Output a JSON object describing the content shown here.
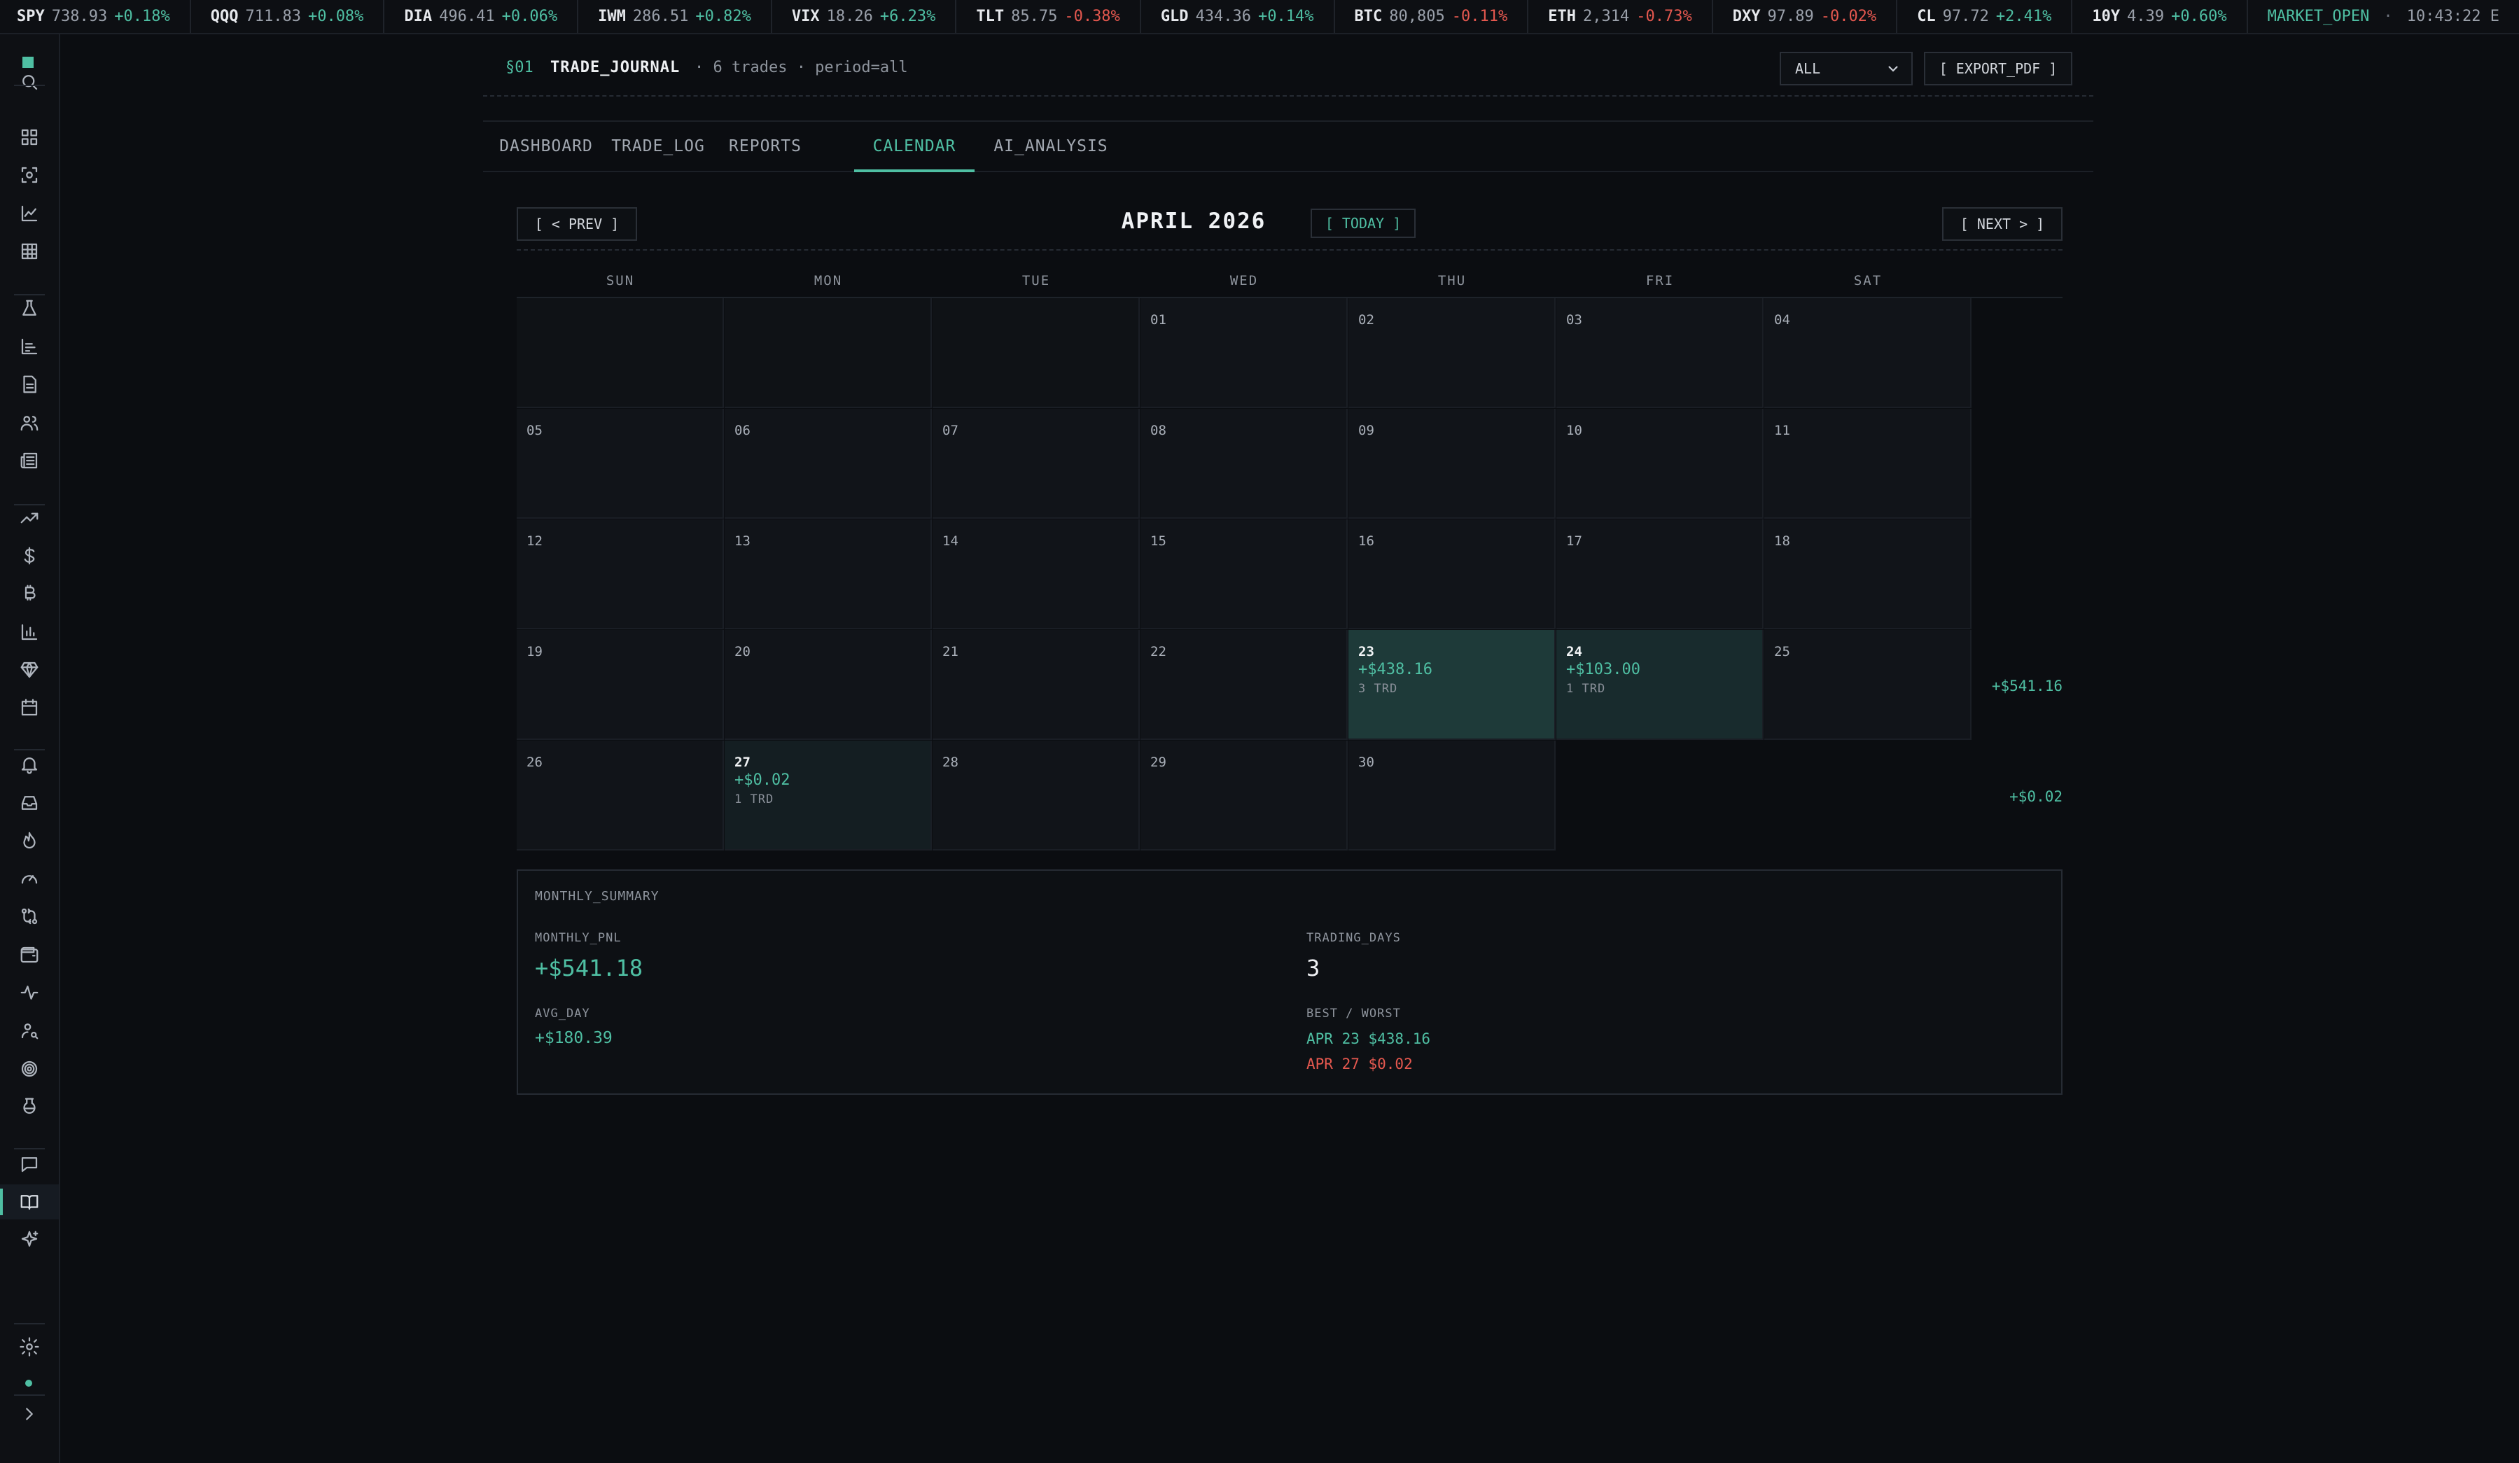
{
  "ticker": [
    {
      "symbol": "SPY",
      "price": "738.93",
      "change": "+0.18%",
      "dir": "up"
    },
    {
      "symbol": "QQQ",
      "price": "711.83",
      "change": "+0.08%",
      "dir": "up"
    },
    {
      "symbol": "DIA",
      "price": "496.41",
      "change": "+0.06%",
      "dir": "up"
    },
    {
      "symbol": "IWM",
      "price": "286.51",
      "change": "+0.82%",
      "dir": "up"
    },
    {
      "symbol": "VIX",
      "price": "18.26",
      "change": "+6.23%",
      "dir": "up"
    },
    {
      "symbol": "TLT",
      "price": "85.75",
      "change": "-0.38%",
      "dir": "down"
    },
    {
      "symbol": "GLD",
      "price": "434.36",
      "change": "+0.14%",
      "dir": "up"
    },
    {
      "symbol": "BTC",
      "price": "80,805",
      "change": "-0.11%",
      "dir": "down"
    },
    {
      "symbol": "ETH",
      "price": "2,314",
      "change": "-0.73%",
      "dir": "down"
    },
    {
      "symbol": "DXY",
      "price": "97.89",
      "change": "-0.02%",
      "dir": "down"
    },
    {
      "symbol": "CL",
      "price": "97.72",
      "change": "+2.41%",
      "dir": "up"
    },
    {
      "symbol": "10Y",
      "price": "4.39",
      "change": "+0.60%",
      "dir": "up"
    }
  ],
  "market": {
    "status": "MARKET_OPEN",
    "separator": "·",
    "clock": "10:43:22 E"
  },
  "sidebar_icons": [
    "logo-icon",
    "search-icon",
    "dashboard-icon",
    "scan-icon",
    "line-chart-icon",
    "grid-icon",
    "flask-icon",
    "bar-chart-icon",
    "document-icon",
    "users-icon",
    "newspaper-icon",
    "trending-up-icon",
    "dollar-icon",
    "bitcoin-icon",
    "column-chart-icon",
    "gem-icon",
    "calendar-icon",
    "bell-icon",
    "inbox-icon",
    "flame-icon",
    "gauge-icon",
    "exchange-icon",
    "wallet-icon",
    "activity-icon",
    "user-search-icon",
    "target-icon",
    "beaker-icon",
    "chat-icon",
    "book-open-icon",
    "sparkles-icon",
    "settings-icon",
    "expand-icon"
  ],
  "header": {
    "section": "§01",
    "title": "TRADE_JOURNAL",
    "meta": "· 6 trades · period=all",
    "filter_value": "ALL",
    "export_label": "[ EXPORT_PDF ]"
  },
  "tabs": [
    {
      "label": "DASHBOARD",
      "active": false
    },
    {
      "label": "TRADE_LOG",
      "active": false
    },
    {
      "label": "REPORTS",
      "active": false
    },
    {
      "label": "CALENDAR",
      "active": true
    },
    {
      "label": "AI_ANALYSIS",
      "active": false
    }
  ],
  "calendar": {
    "prev_label": "[ < PREV ]",
    "next_label": "[ NEXT > ]",
    "month_title": "APRIL 2026",
    "today_label": "[ TODAY ]",
    "weekdays": [
      "SUN",
      "MON",
      "TUE",
      "WED",
      "THU",
      "FRI",
      "SAT"
    ],
    "weeks": [
      {
        "days": [
          null,
          null,
          null,
          {
            "d": "01"
          },
          {
            "d": "02"
          },
          {
            "d": "03"
          },
          {
            "d": "04"
          }
        ],
        "total": ""
      },
      {
        "days": [
          {
            "d": "05"
          },
          {
            "d": "06"
          },
          {
            "d": "07"
          },
          {
            "d": "08"
          },
          {
            "d": "09"
          },
          {
            "d": "10"
          },
          {
            "d": "11"
          }
        ],
        "total": ""
      },
      {
        "days": [
          {
            "d": "12"
          },
          {
            "d": "13"
          },
          {
            "d": "14"
          },
          {
            "d": "15"
          },
          {
            "d": "16"
          },
          {
            "d": "17"
          },
          {
            "d": "18"
          }
        ],
        "total": ""
      },
      {
        "days": [
          {
            "d": "19"
          },
          {
            "d": "20"
          },
          {
            "d": "21"
          },
          {
            "d": "22"
          },
          {
            "d": "23",
            "pnl": "+$438.16",
            "trades": "3 TRD",
            "level": "hi"
          },
          {
            "d": "24",
            "pnl": "+$103.00",
            "trades": "1 TRD",
            "level": "md"
          },
          {
            "d": "25"
          }
        ],
        "total": "+$541.16"
      },
      {
        "days": [
          {
            "d": "26"
          },
          {
            "d": "27",
            "pnl": "+$0.02",
            "trades": "1 TRD",
            "level": "lo"
          },
          {
            "d": "28"
          },
          {
            "d": "29"
          },
          {
            "d": "30"
          },
          "blank",
          "blank"
        ],
        "total": "+$0.02"
      }
    ]
  },
  "summary": {
    "heading": "MONTHLY_SUMMARY",
    "monthly_pnl_label": "MONTHLY_PNL",
    "monthly_pnl": "+$541.18",
    "trading_days_label": "TRADING_DAYS",
    "trading_days": "3",
    "avg_day_label": "AVG_DAY",
    "avg_day": "+$180.39",
    "best_worst_label": "BEST / WORST",
    "best": "APR 23 $438.16",
    "worst": "APR 27 $0.02"
  },
  "colors": {
    "accent": "#4fbfa3",
    "negative": "#e5584f",
    "background": "#0b0d11"
  }
}
